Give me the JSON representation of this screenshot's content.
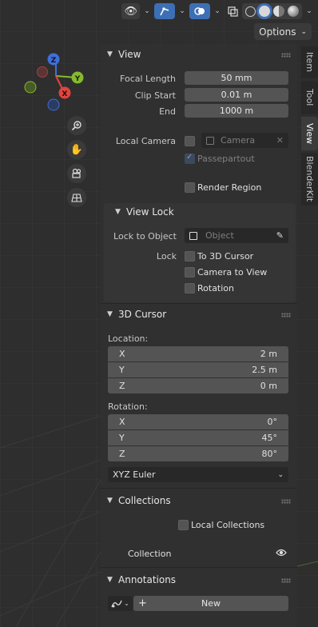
{
  "header": {
    "options_label": "Options"
  },
  "tabs": [
    {
      "label": "Item"
    },
    {
      "label": "Tool"
    },
    {
      "label": "View"
    },
    {
      "label": "BlenderKit"
    }
  ],
  "view": {
    "title": "View",
    "focal_length_label": "Focal Length",
    "focal_length_value": "50 mm",
    "clip_start_label": "Clip Start",
    "clip_start_value": "0.01 m",
    "end_label": "End",
    "end_value": "1000 m",
    "local_camera_label": "Local Camera",
    "camera_placeholder": "Camera",
    "passepartout_label": "Passepartout",
    "render_region_label": "Render Region"
  },
  "view_lock": {
    "title": "View Lock",
    "lock_to_object_label": "Lock to Object",
    "object_placeholder": "Object",
    "lock_label": "Lock",
    "to_3d_cursor_label": "To 3D Cursor",
    "camera_to_view_label": "Camera to View",
    "rotation_label": "Rotation"
  },
  "cursor": {
    "title": "3D Cursor",
    "location_label": "Location:",
    "location": [
      {
        "axis": "X",
        "value": "2 m"
      },
      {
        "axis": "Y",
        "value": "2.5 m"
      },
      {
        "axis": "Z",
        "value": "0 m"
      }
    ],
    "rotation_label": "Rotation:",
    "rotation": [
      {
        "axis": "X",
        "value": "0°"
      },
      {
        "axis": "Y",
        "value": "45°"
      },
      {
        "axis": "Z",
        "value": "80°"
      }
    ],
    "rotation_mode": "XYZ Euler"
  },
  "collections": {
    "title": "Collections",
    "local_collections_label": "Local Collections",
    "collection_label": "Collection"
  },
  "annotations": {
    "title": "Annotations",
    "new_label": "New"
  },
  "gizmo": {
    "z": "Z",
    "y": "Y",
    "x": "X"
  },
  "colors": {
    "accent": "#3d6fb5",
    "axis_x": "#e0453f",
    "axis_y": "#86b92f",
    "axis_z": "#3f6fd8"
  }
}
